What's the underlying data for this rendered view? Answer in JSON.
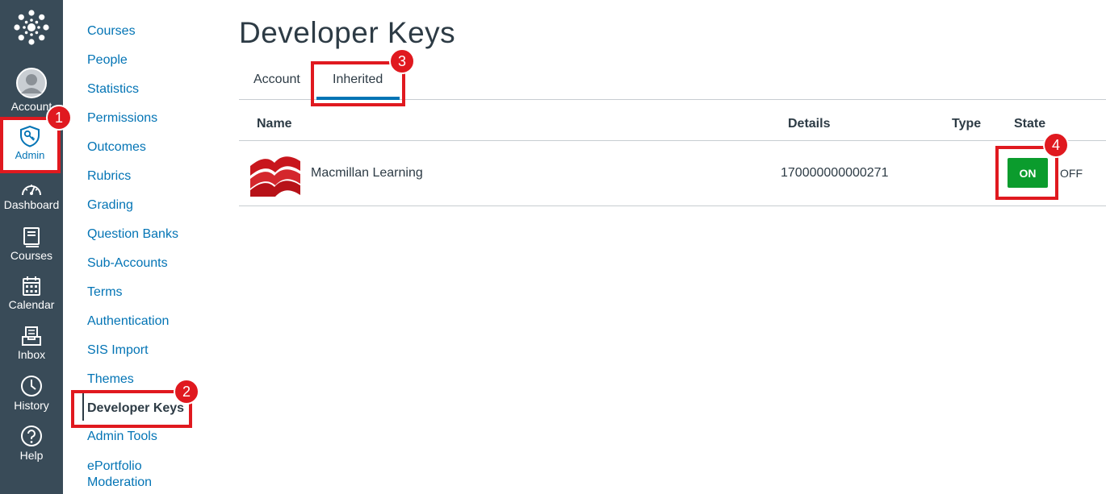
{
  "global_nav": {
    "account_label": "Account",
    "admin_label": "Admin",
    "dashboard_label": "Dashboard",
    "courses_label": "Courses",
    "calendar_label": "Calendar",
    "inbox_label": "Inbox",
    "history_label": "History",
    "help_label": "Help"
  },
  "sub_nav": {
    "items": [
      "Courses",
      "People",
      "Statistics",
      "Permissions",
      "Outcomes",
      "Rubrics",
      "Grading",
      "Question Banks",
      "Sub-Accounts",
      "Terms",
      "Authentication",
      "SIS Import",
      "Themes",
      "Developer Keys",
      "Admin Tools",
      "ePortfolio Moderation"
    ],
    "active": "Developer Keys"
  },
  "page": {
    "title": "Developer Keys",
    "tabs": [
      "Account",
      "Inherited"
    ],
    "active_tab": "Inherited"
  },
  "table": {
    "headers": [
      "Name",
      "Details",
      "Type",
      "State"
    ],
    "rows": [
      {
        "name": "Macmillan Learning",
        "details": "170000000000271",
        "type": "",
        "state_on": "ON",
        "state_off": "OFF"
      }
    ]
  },
  "annotations": [
    "1",
    "2",
    "3",
    "4"
  ],
  "colors": {
    "nav_bg": "#394b58",
    "link": "#0374b5",
    "on_button": "#0b9c2d",
    "highlight": "#e0191f"
  }
}
